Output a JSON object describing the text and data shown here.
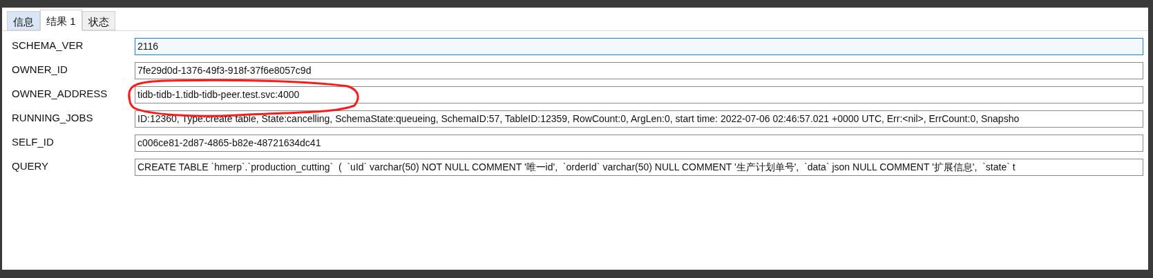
{
  "tabs": [
    {
      "label": "信息",
      "selected": false,
      "hovered": true
    },
    {
      "label": "结果 1",
      "selected": true,
      "hovered": false
    },
    {
      "label": "状态",
      "selected": false,
      "hovered": false
    }
  ],
  "fields": [
    {
      "label": "SCHEMA_VER",
      "value": "2116",
      "focused": true
    },
    {
      "label": "OWNER_ID",
      "value": "7fe29d0d-1376-49f3-918f-37f6e8057c9d",
      "focused": false
    },
    {
      "label": "OWNER_ADDRESS",
      "value": "tidb-tidb-1.tidb-tidb-peer.test.svc:4000",
      "focused": false
    },
    {
      "label": "RUNNING_JOBS",
      "value": "ID:12360, Type:create table, State:cancelling, SchemaState:queueing, SchemaID:57, TableID:12359, RowCount:0, ArgLen:0, start time: 2022-07-06 02:46:57.021 +0000 UTC, Err:<nil>, ErrCount:0, Snapsho",
      "focused": false
    },
    {
      "label": "SELF_ID",
      "value": "c006ce81-2d87-4865-b82e-48721634dc41",
      "focused": false
    },
    {
      "label": "QUERY",
      "value": "CREATE TABLE `hmerp`.`production_cutting`  (  `uId` varchar(50) NOT NULL COMMENT '唯一id',  `orderId` varchar(50) NULL COMMENT '生产计划单号',  `data` json NULL COMMENT '扩展信息',  `state` t",
      "focused": false
    }
  ]
}
